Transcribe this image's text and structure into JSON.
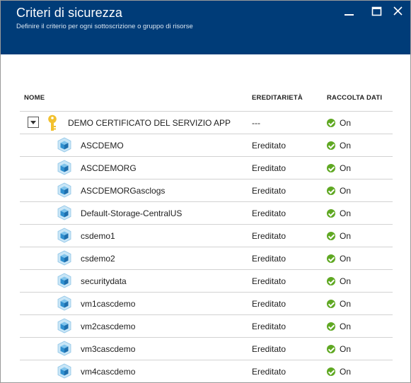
{
  "header": {
    "title": "Criteri di sicurezza",
    "subtitle": "Definire il criterio per ogni sottoscrizione o gruppo di risorse"
  },
  "columns": {
    "name": "NOME",
    "inheritance": "EREDITARIETÀ",
    "data_collection": "RACCOLTA DATI"
  },
  "parent": {
    "name": "DEMO CERTIFICATO DEL SERVIZIO APP",
    "inheritance": "---",
    "data_collection": "On"
  },
  "rows": [
    {
      "name": "ASCDEMO",
      "inheritance": "Ereditato",
      "data_collection": "On"
    },
    {
      "name": "ASCDEMORG",
      "inheritance": "Ereditato",
      "data_collection": "On"
    },
    {
      "name": "ASCDEMORGasclogs",
      "inheritance": "Ereditato",
      "data_collection": "On"
    },
    {
      "name": "Default-Storage-CentralUS",
      "inheritance": "Ereditato",
      "data_collection": "On"
    },
    {
      "name": "csdemo1",
      "inheritance": "Ereditato",
      "data_collection": "On"
    },
    {
      "name": "csdemo2",
      "inheritance": "Ereditato",
      "data_collection": "On"
    },
    {
      "name": "securitydata",
      "inheritance": "Ereditato",
      "data_collection": "On"
    },
    {
      "name": "vm1cascdemo",
      "inheritance": "Ereditato",
      "data_collection": "On"
    },
    {
      "name": "vm2cascdemo",
      "inheritance": "Ereditato",
      "data_collection": "On"
    },
    {
      "name": "vm3cascdemo",
      "inheritance": "Ereditato",
      "data_collection": "On"
    },
    {
      "name": "vm4cascdemo",
      "inheritance": "Ereditato",
      "data_collection": "On"
    }
  ],
  "colors": {
    "header_bg": "#003c78",
    "status_on": "#5fa822",
    "cube": "#3d9fd9",
    "key": "#f2c12e"
  }
}
